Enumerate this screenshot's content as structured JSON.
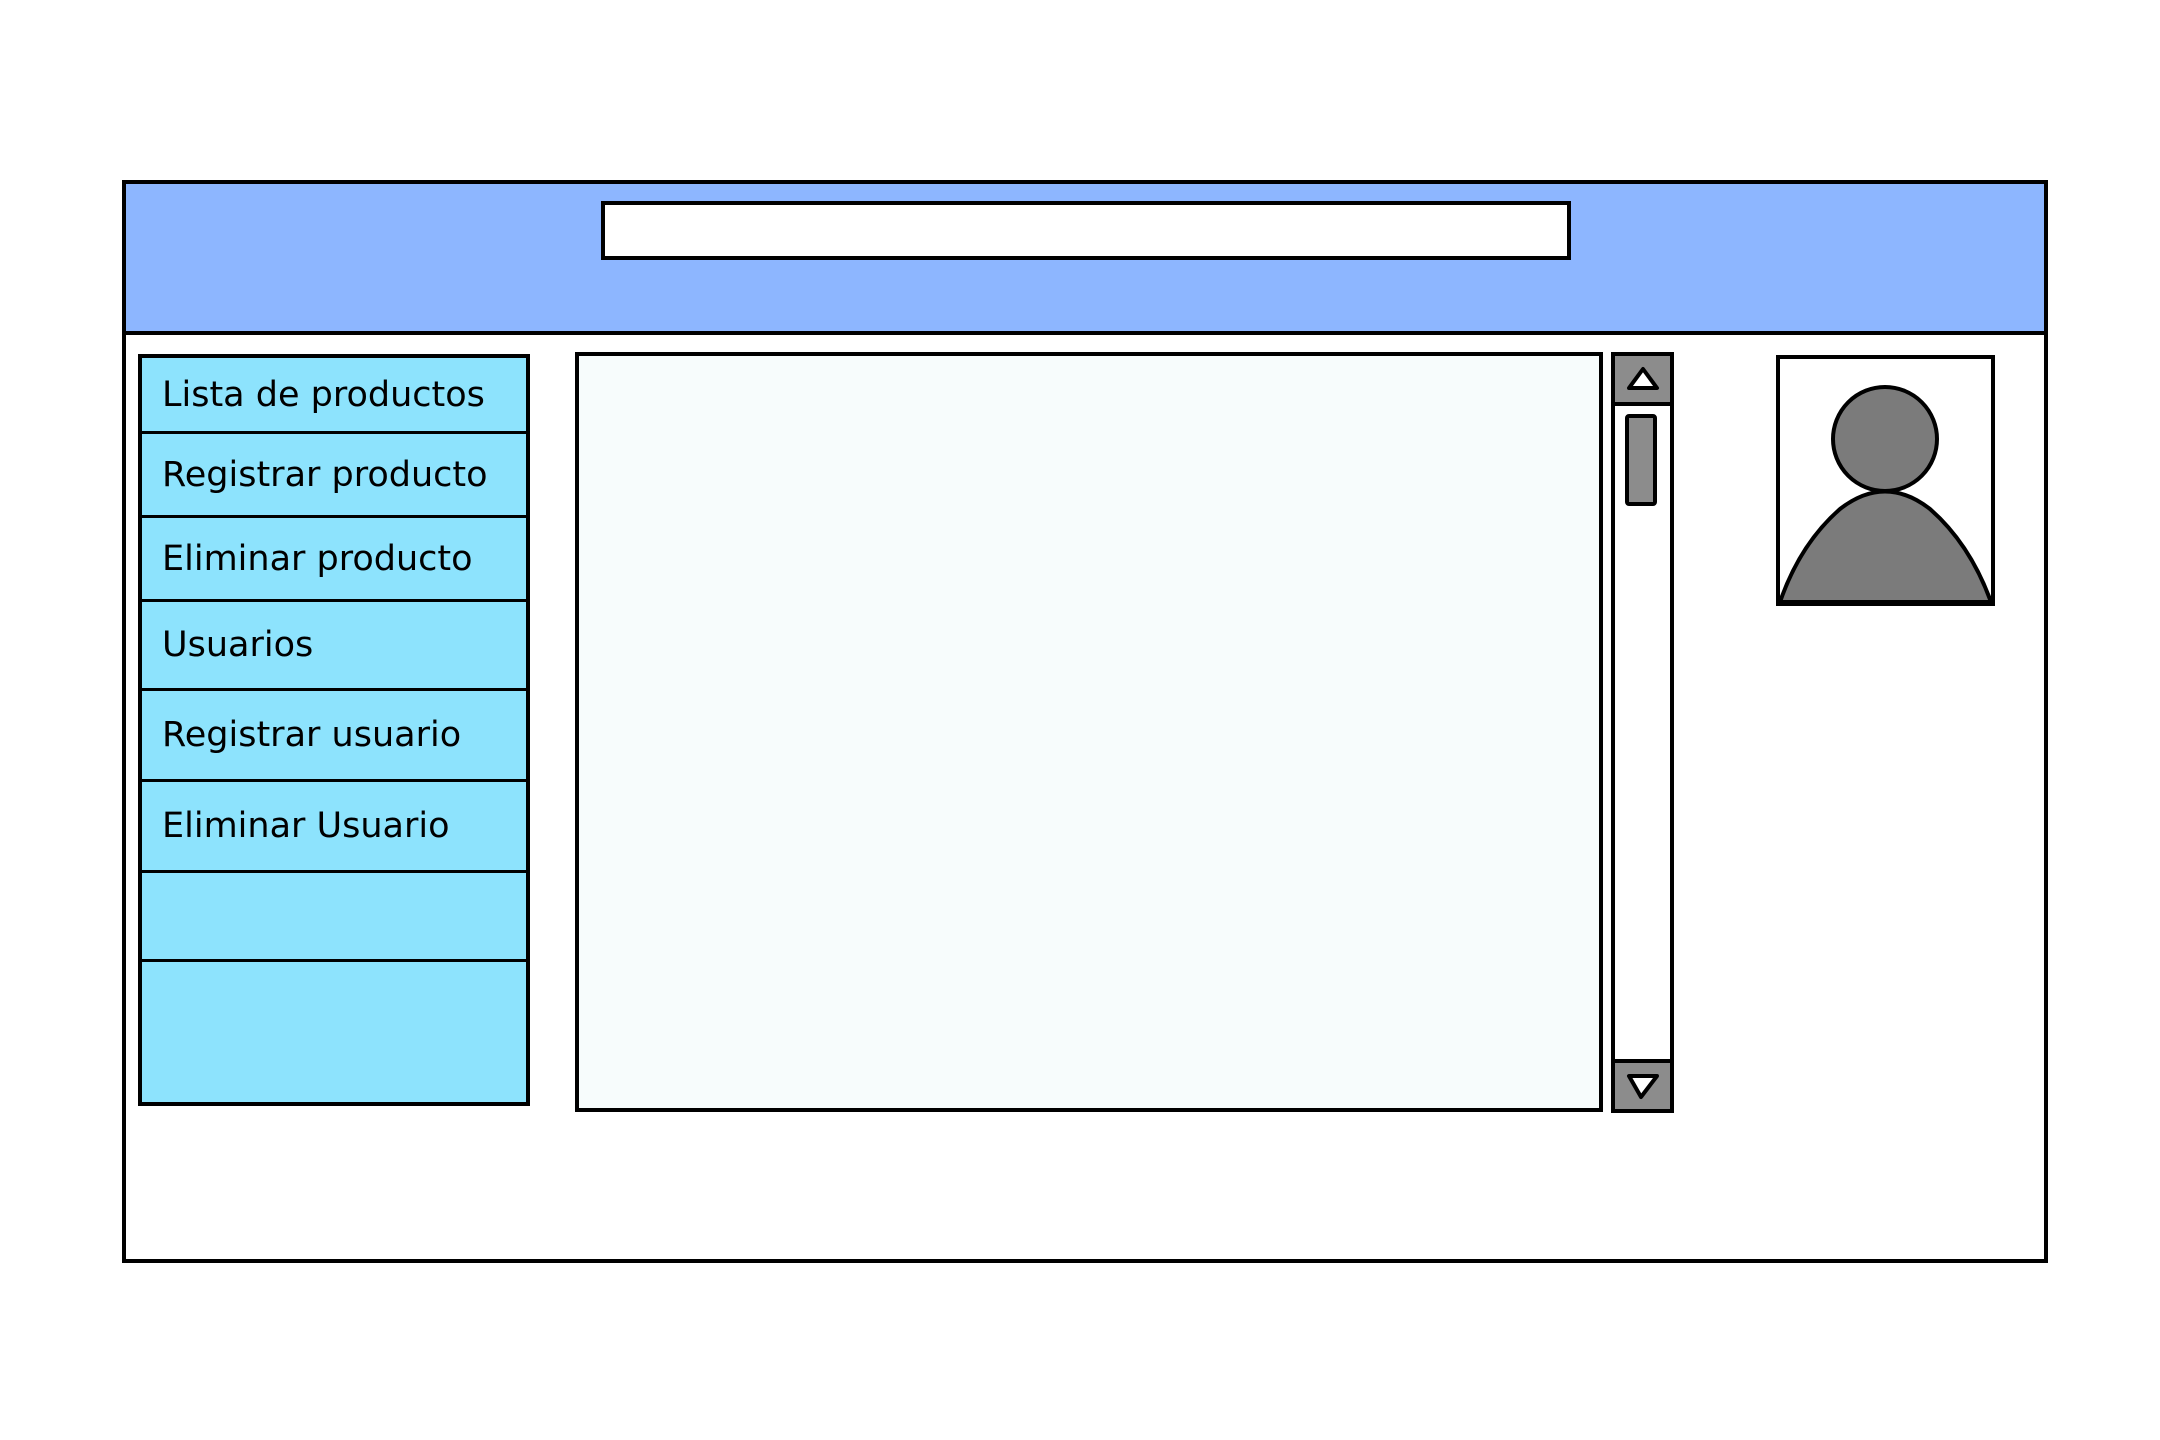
{
  "header": {
    "search_value": "",
    "search_placeholder": ""
  },
  "sidebar": {
    "items": [
      {
        "label": "Lista de productos"
      },
      {
        "label": "Registrar producto"
      },
      {
        "label": "Eliminar producto"
      },
      {
        "label": "Usuarios"
      },
      {
        "label": "Registrar usuario"
      },
      {
        "label": "Eliminar Usuario"
      },
      {
        "label": ""
      },
      {
        "label": ""
      }
    ]
  },
  "icons": {
    "scroll_up": "triangle-up-icon",
    "scroll_down": "triangle-down-icon",
    "avatar": "user-icon"
  },
  "colors": {
    "header_bg": "#8db6ff",
    "sidebar_bg": "#8de3fd",
    "content_bg": "#f7fcfc",
    "scroll_gray": "#8c8c8c",
    "avatar_gray": "#7b7b7b"
  }
}
